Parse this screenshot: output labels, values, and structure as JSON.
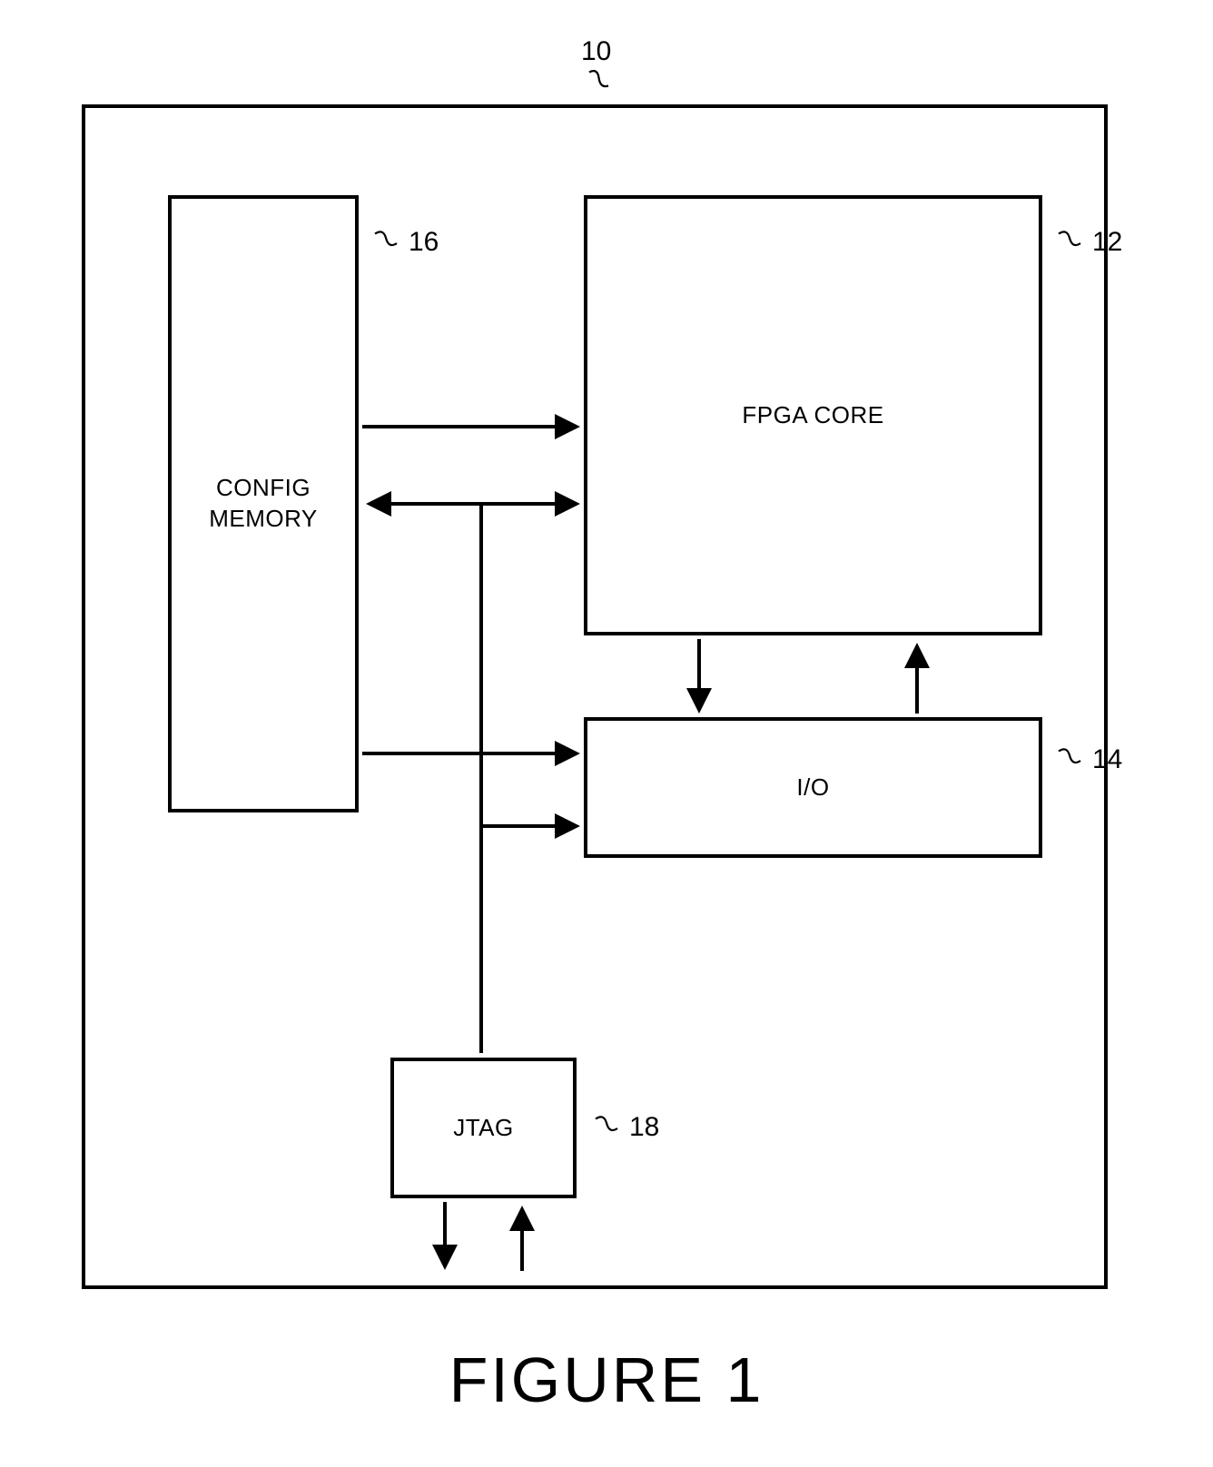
{
  "blocks": {
    "config_memory": "CONFIG\nMEMORY",
    "fpga_core": "FPGA CORE",
    "io": "I/O",
    "jtag": "JTAG"
  },
  "refs": {
    "outer": "10",
    "fpga_core": "12",
    "io": "14",
    "config_memory": "16",
    "jtag": "18"
  },
  "figure_title": "FIGURE 1"
}
